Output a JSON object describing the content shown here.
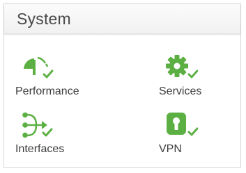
{
  "panel": {
    "title": "System"
  },
  "colors": {
    "accent_green": "#5cb043",
    "title_text": "#4a4a4a",
    "label_text": "#3c3c3c"
  },
  "tiles": [
    {
      "label": "Performance",
      "icon": "gauge-icon"
    },
    {
      "label": "Services",
      "icon": "gear-icon"
    },
    {
      "label": "Interfaces",
      "icon": "network-split-icon"
    },
    {
      "label": "VPN",
      "icon": "lock-icon"
    }
  ]
}
